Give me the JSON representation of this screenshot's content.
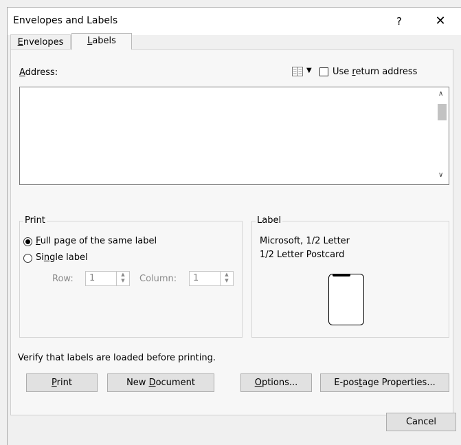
{
  "window": {
    "title": "Envelopes and Labels",
    "help_glyph": "?",
    "close_glyph": "✕"
  },
  "tabs": [
    {
      "label_hotkey": "E",
      "label_rest": "nvelopes",
      "selected": false
    },
    {
      "label_hotkey": "L",
      "label_rest": "abels",
      "selected": true
    }
  ],
  "address": {
    "label_hotkey": "A",
    "label_rest": "ddress:",
    "value": "",
    "dropdown_glyph": "▼",
    "use_return_pre": "Use ",
    "use_return_hotkey": "r",
    "use_return_post": "eturn address",
    "use_return_checked": false
  },
  "print_group": {
    "legend": "Print",
    "full_page_hotkey": "F",
    "full_page_rest": "ull page of the same label",
    "full_page_selected": true,
    "single_pre": "Si",
    "single_hotkey": "n",
    "single_post": "gle label",
    "single_selected": false,
    "row_label": "Row:",
    "row_value": "1",
    "column_label": "Column:",
    "column_value": "1"
  },
  "label_group": {
    "legend": "Label",
    "line1": "Microsoft, 1/2 Letter",
    "line2": "1/2 Letter Postcard"
  },
  "verify_text": "Verify that labels are loaded before printing.",
  "buttons": {
    "print_hotkey": "P",
    "print_rest": "rint",
    "new_doc_pre": "New ",
    "new_doc_hotkey": "D",
    "new_doc_post": "ocument",
    "options_hotkey": "O",
    "options_rest": "ptions...",
    "epostage_pre": "E-pos",
    "epostage_hotkey": "t",
    "epostage_post": "age Properties...",
    "cancel": "Cancel"
  },
  "spin_up_glyph": "▲",
  "spin_down_glyph": "▼",
  "scroll_up_glyph": "∧",
  "scroll_down_glyph": "∨"
}
